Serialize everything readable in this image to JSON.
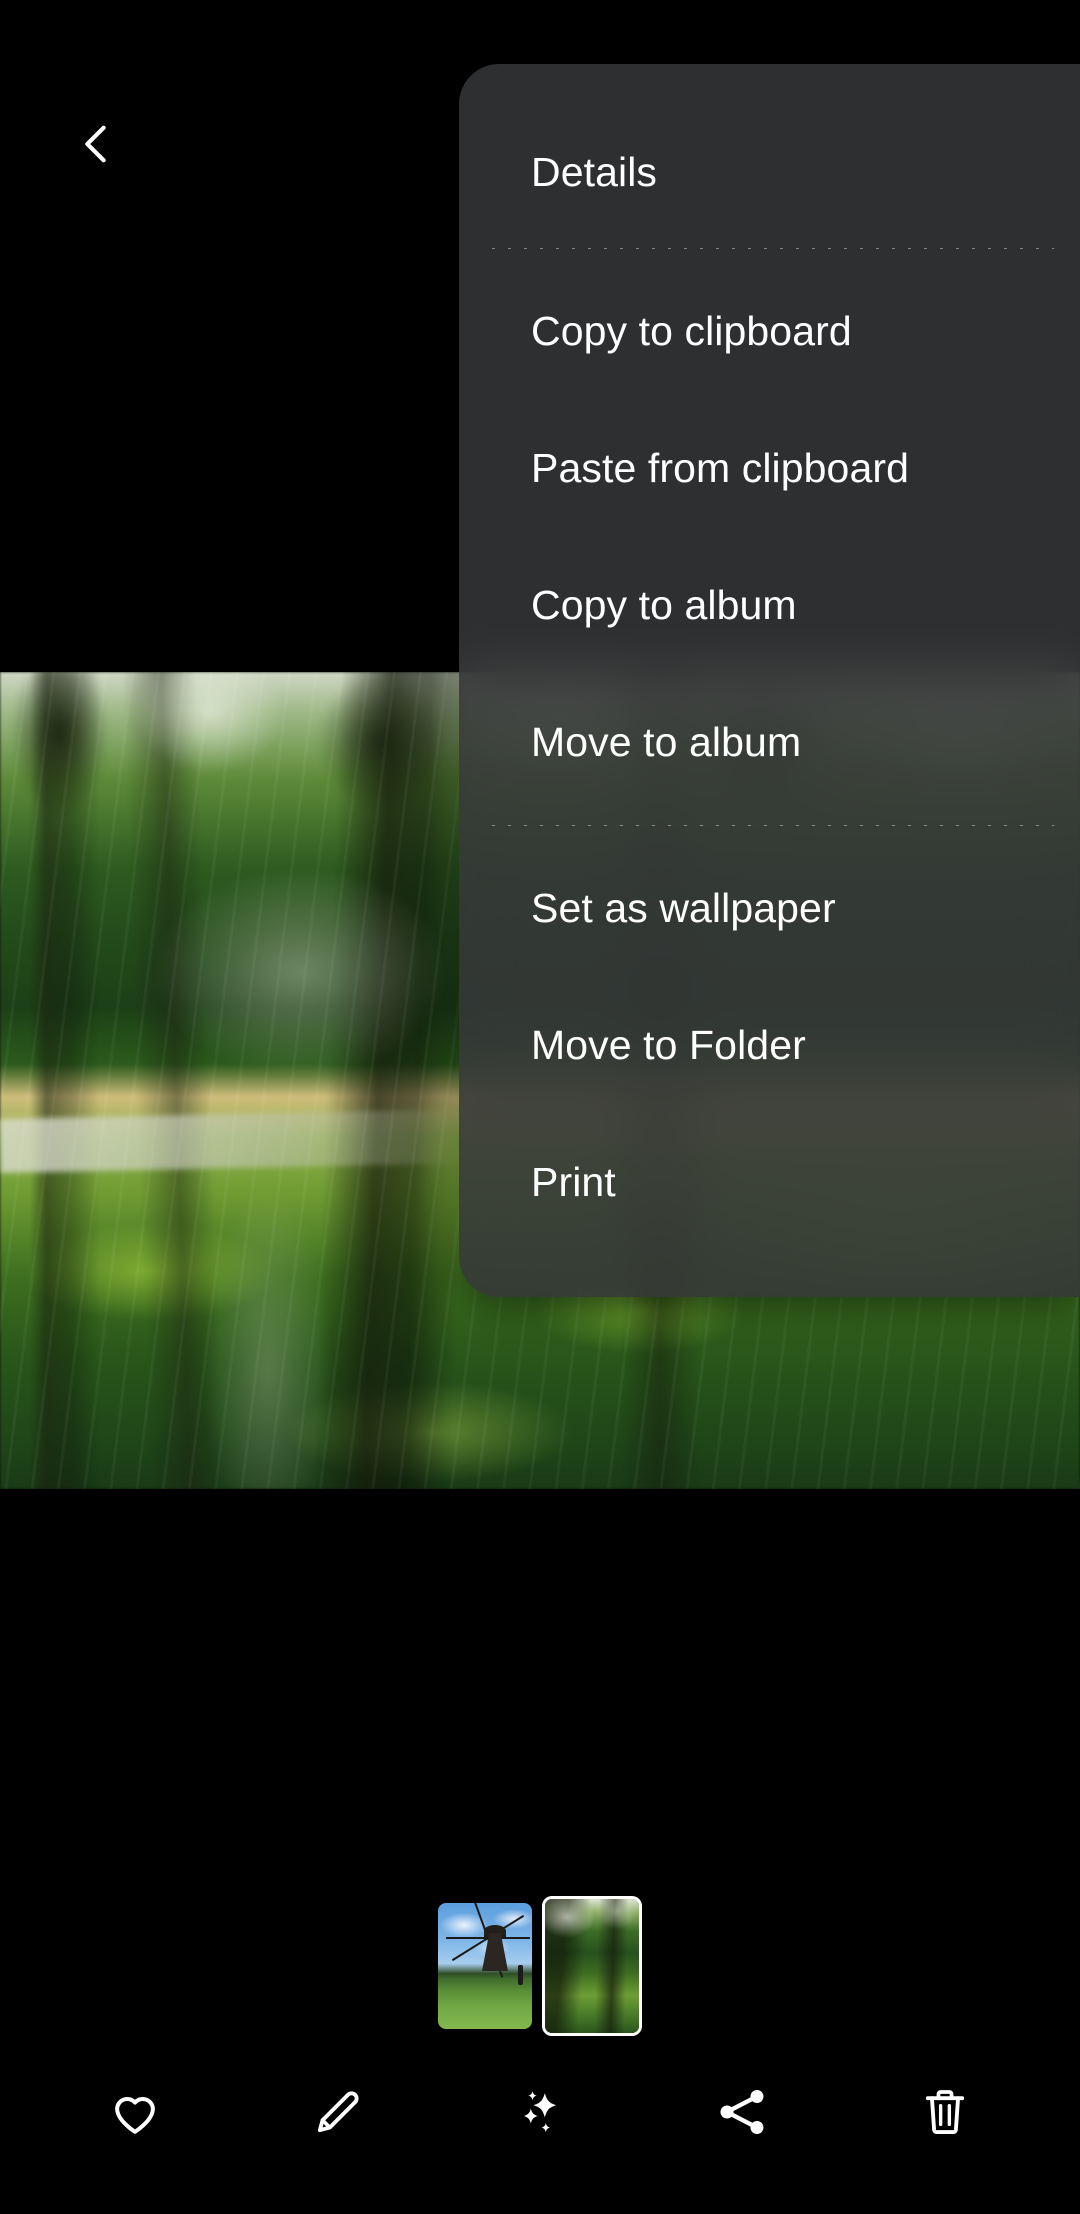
{
  "screen": {
    "app": "photo-viewer",
    "background_color": "#000000"
  },
  "topbar": {
    "back_icon": "chevron-left-icon"
  },
  "menu": {
    "background_color": "#343638",
    "text_color": "#ffffff",
    "groups": [
      {
        "items": [
          {
            "label": "Details",
            "icon": "details-item"
          }
        ]
      },
      {
        "items": [
          {
            "label": "Copy to clipboard",
            "icon": "copy-clipboard-item"
          },
          {
            "label": "Paste from clipboard",
            "icon": "paste-clipboard-item"
          },
          {
            "label": "Copy to album",
            "icon": "copy-album-item"
          },
          {
            "label": "Move to album",
            "icon": "move-album-item"
          }
        ]
      },
      {
        "items": [
          {
            "label": "Set as wallpaper",
            "icon": "set-wallpaper-item"
          },
          {
            "label": "Move to Folder",
            "icon": "move-folder-item"
          },
          {
            "label": "Print",
            "icon": "print-item"
          }
        ]
      }
    ]
  },
  "photo": {
    "description": "Motion-blurred park scene with trees, green grass and a path",
    "alt": "park-photo"
  },
  "filmstrip": {
    "thumbnails": [
      {
        "name": "thumbnail-windmill",
        "alt": "Windmill on a green field",
        "selected": false
      },
      {
        "name": "thumbnail-park",
        "alt": "Park with trees",
        "selected": true
      }
    ]
  },
  "toolbar": {
    "buttons": [
      {
        "name": "favorite-button",
        "icon": "heart-icon",
        "label": "Favorite"
      },
      {
        "name": "edit-button",
        "icon": "pencil-icon",
        "label": "Edit"
      },
      {
        "name": "enhance-button",
        "icon": "sparkles-icon",
        "label": "Enhance"
      },
      {
        "name": "share-button",
        "icon": "share-icon",
        "label": "Share"
      },
      {
        "name": "delete-button",
        "icon": "trash-icon",
        "label": "Delete"
      }
    ]
  }
}
